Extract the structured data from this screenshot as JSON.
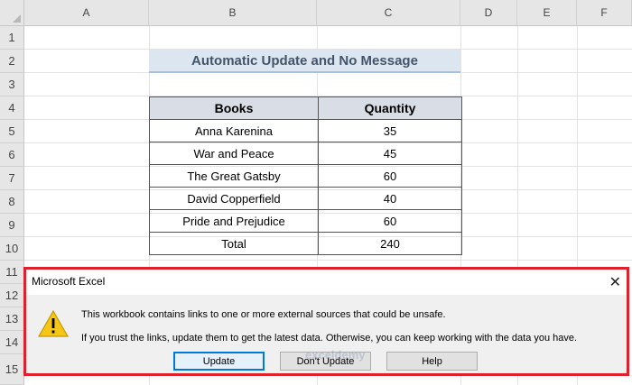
{
  "spreadsheet": {
    "columns": [
      "A",
      "B",
      "C",
      "D",
      "E",
      "F"
    ],
    "rows": [
      "1",
      "2",
      "3",
      "4",
      "5",
      "6",
      "7",
      "8",
      "9",
      "10",
      "11",
      "12",
      "13",
      "14",
      "15"
    ],
    "title": "Automatic Update and No Message",
    "table": {
      "headers": [
        "Books",
        "Quantity"
      ],
      "rows": [
        {
          "book": "Anna Karenina",
          "qty": "35"
        },
        {
          "book": "War and Peace",
          "qty": "45"
        },
        {
          "book": "The Great Gatsby",
          "qty": "60"
        },
        {
          "book": "David Copperfield",
          "qty": "40"
        },
        {
          "book": "Pride and Prejudice",
          "qty": "60"
        },
        {
          "book": "Total",
          "qty": "240"
        }
      ]
    }
  },
  "dialog": {
    "title": "Microsoft Excel",
    "close": "✕",
    "message1": "This workbook contains links to one or more external sources that could be unsafe.",
    "message2": "If you trust the links, update them to get the latest data. Otherwise, you can keep working with the data you have.",
    "buttons": {
      "update": "Update",
      "dont_update": "Don't Update",
      "help": "Help"
    },
    "icon": "warning-icon"
  },
  "watermark": "exceldemy",
  "colors": {
    "highlight_frame": "#e0202a",
    "title_fill": "#dce6f1",
    "title_text": "#44546a",
    "header_fill": "#d9dde6"
  }
}
